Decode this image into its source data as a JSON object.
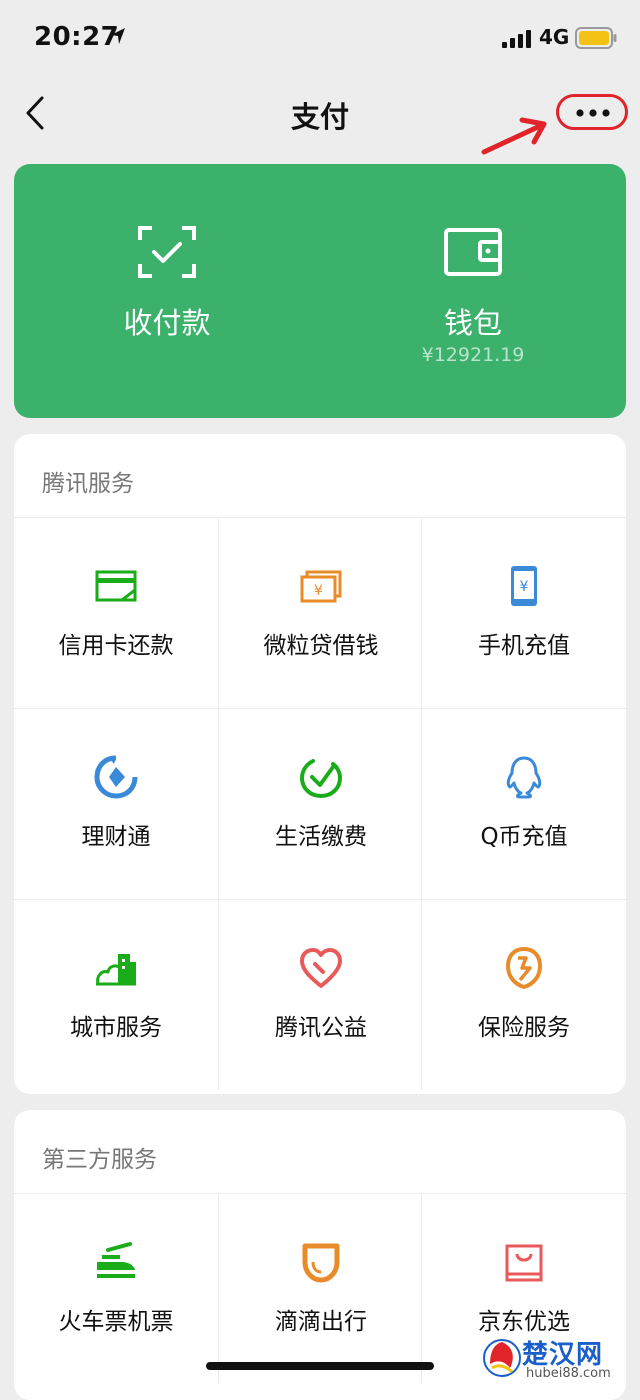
{
  "status": {
    "time": "20:27",
    "network": "4G"
  },
  "nav": {
    "title": "支付"
  },
  "pay_card": {
    "receive": {
      "label": "收付款"
    },
    "wallet": {
      "label": "钱包",
      "balance": "¥12921.19"
    }
  },
  "tencent_services": {
    "title": "腾讯服务",
    "items": [
      {
        "label": "信用卡还款",
        "icon": "credit-card-icon",
        "color": "#1aad19"
      },
      {
        "label": "微粒贷借钱",
        "icon": "loan-icon",
        "color": "#e88b2a"
      },
      {
        "label": "手机充值",
        "icon": "phone-topup-icon",
        "color": "#3a8ad8"
      },
      {
        "label": "理财通",
        "icon": "wealth-icon",
        "color": "#3a8ad8"
      },
      {
        "label": "生活缴费",
        "icon": "utility-icon",
        "color": "#1aad19"
      },
      {
        "label": "Q币充值",
        "icon": "qq-icon",
        "color": "#3a8ad8"
      },
      {
        "label": "城市服务",
        "icon": "city-icon",
        "color": "#1aad19"
      },
      {
        "label": "腾讯公益",
        "icon": "charity-icon",
        "color": "#e85a5a"
      },
      {
        "label": "保险服务",
        "icon": "insurance-icon",
        "color": "#e88b2a"
      }
    ]
  },
  "third_party_services": {
    "title": "第三方服务",
    "items": [
      {
        "label": "火车票机票",
        "icon": "train-icon",
        "color": "#1aad19"
      },
      {
        "label": "滴滴出行",
        "icon": "didi-icon",
        "color": "#e88b2a"
      },
      {
        "label": "京东优选",
        "icon": "jd-bag-icon",
        "color": "#e85a5a"
      }
    ]
  },
  "watermark": {
    "name": "楚汉网",
    "url": "hubei88.com"
  }
}
